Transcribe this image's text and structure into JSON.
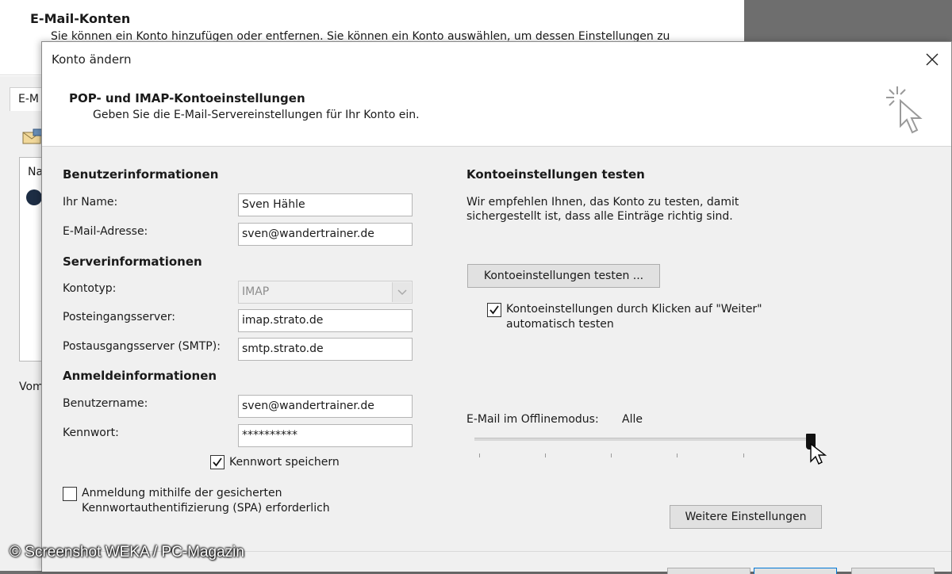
{
  "background_window": {
    "title": "E-Mail-Konten",
    "description": "Sie können ein Konto hinzufügen oder entfernen. Sie können ein Konto auswählen, um dessen Einstellungen zu",
    "tab_label": "E-M",
    "list_header": "Na",
    "footer_text": "Vom"
  },
  "dialog": {
    "title": "Konto ändern",
    "section_title": "POP- und IMAP-Kontoeinstellungen",
    "section_subtitle": "Geben Sie die E-Mail-Servereinstellungen für Ihr Konto ein."
  },
  "user_info": {
    "heading": "Benutzerinformationen",
    "name_label": "Ihr Name:",
    "name_value": "Sven Hähle",
    "email_label": "E-Mail-Adresse:",
    "email_value": "sven@wandertrainer.de"
  },
  "server_info": {
    "heading": "Serverinformationen",
    "account_type_label": "Kontotyp:",
    "account_type_value": "IMAP",
    "incoming_label": "Posteingangsserver:",
    "incoming_value": "imap.strato.de",
    "outgoing_label": "Postausgangsserver (SMTP):",
    "outgoing_value": "smtp.strato.de"
  },
  "login_info": {
    "heading": "Anmeldeinformationen",
    "username_label": "Benutzername:",
    "username_value": "sven@wandertrainer.de",
    "password_label": "Kennwort:",
    "password_value": "**********",
    "remember_password_label": "Kennwort speichern",
    "remember_password_checked": true,
    "spa_label_line1": "Anmeldung mithilfe der gesicherten",
    "spa_label_line2": "Kennwortauthentifizierung (SPA) erforderlich",
    "spa_checked": false
  },
  "test_settings": {
    "heading": "Kontoeinstellungen testen",
    "description_line1": "Wir empfehlen Ihnen, das Konto zu testen, damit",
    "description_line2": "sichergestellt ist, dass alle Einträge richtig sind.",
    "test_button": "Kontoeinstellungen testen ...",
    "auto_test_line1": "Kontoeinstellungen durch Klicken auf \"Weiter\"",
    "auto_test_line2": "automatisch testen",
    "auto_test_checked": true
  },
  "offline": {
    "label": "E-Mail im Offlinemodus:",
    "value": "Alle",
    "slider_position": 1.0
  },
  "more_settings_button": "Weitere Einstellungen",
  "watermark": "© Screenshot WEKA / PC-Magazin"
}
